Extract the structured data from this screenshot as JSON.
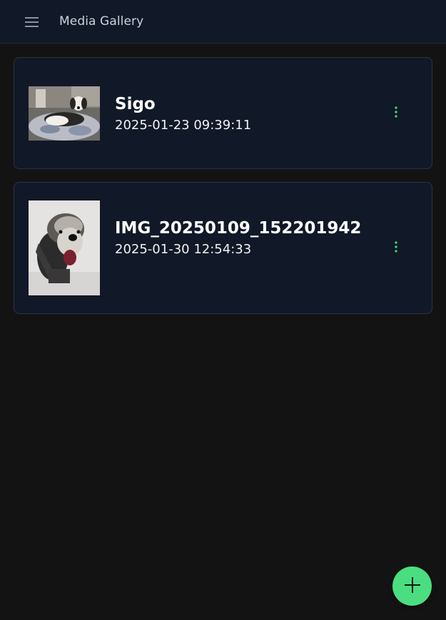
{
  "header": {
    "title": "Media Gallery",
    "menu_icon": "hamburger-menu-icon"
  },
  "media_items": [
    {
      "title": "Sigo",
      "date": "2025-01-23 09:39:11",
      "thumbnail": "dog lying on cushion photo",
      "menu_icon": "more-vertical-icon"
    },
    {
      "title": "IMG_20250109_152201942",
      "date": "2025-01-30 12:54:33",
      "thumbnail": "dog wearing knit hat in snow photo",
      "menu_icon": "more-vertical-icon"
    }
  ],
  "fab": {
    "icon": "plus-icon"
  },
  "colors": {
    "background": "#131313",
    "surface": "#111827",
    "accent": "#4ade80",
    "header_text": "#cbd2dc"
  }
}
